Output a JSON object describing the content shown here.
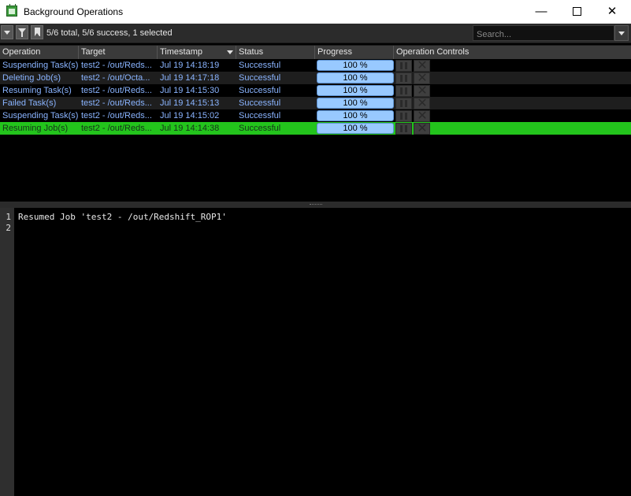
{
  "window": {
    "title": "Background Operations",
    "min_glyph": "—",
    "close_glyph": "✕"
  },
  "toolbar": {
    "summary": "5/6 total, 5/6 success, 1 selected",
    "search_placeholder": "Search..."
  },
  "table": {
    "columns": [
      "Operation",
      "Target",
      "Timestamp",
      "Status",
      "Progress",
      "Operation Controls"
    ],
    "rows": [
      {
        "operation": "Suspending Task(s)",
        "target": "test2 - /out/Reds...",
        "timestamp": "Jul 19 14:18:19",
        "status": "Successful",
        "progress": "100 %"
      },
      {
        "operation": "Deleting Job(s)",
        "target": "test2 - /out/Octa...",
        "timestamp": "Jul 19 14:17:18",
        "status": "Successful",
        "progress": "100 %"
      },
      {
        "operation": "Resuming Task(s)",
        "target": "test2 - /out/Reds...",
        "timestamp": "Jul 19 14:15:30",
        "status": "Successful",
        "progress": "100 %"
      },
      {
        "operation": "Failed Task(s)",
        "target": "test2 - /out/Reds...",
        "timestamp": "Jul 19 14:15:13",
        "status": "Successful",
        "progress": "100 %"
      },
      {
        "operation": "Suspending Task(s)",
        "target": "test2 - /out/Reds...",
        "timestamp": "Jul 19 14:15:02",
        "status": "Successful",
        "progress": "100 %"
      },
      {
        "operation": "Resuming Job(s)",
        "target": "test2 - /out/Reds...",
        "timestamp": "Jul 19 14:14:38",
        "status": "Successful",
        "progress": "100 %"
      }
    ],
    "selected_row": 5
  },
  "log": {
    "line_numbers": [
      "1",
      "2"
    ],
    "lines": [
      "Resumed Job 'test2 - /out/Redshift_ROP1'",
      ""
    ]
  },
  "colors": {
    "selected_row": "#23c41c",
    "row_text": "#8ab4ff",
    "progress_fill": "#98c9ff"
  }
}
